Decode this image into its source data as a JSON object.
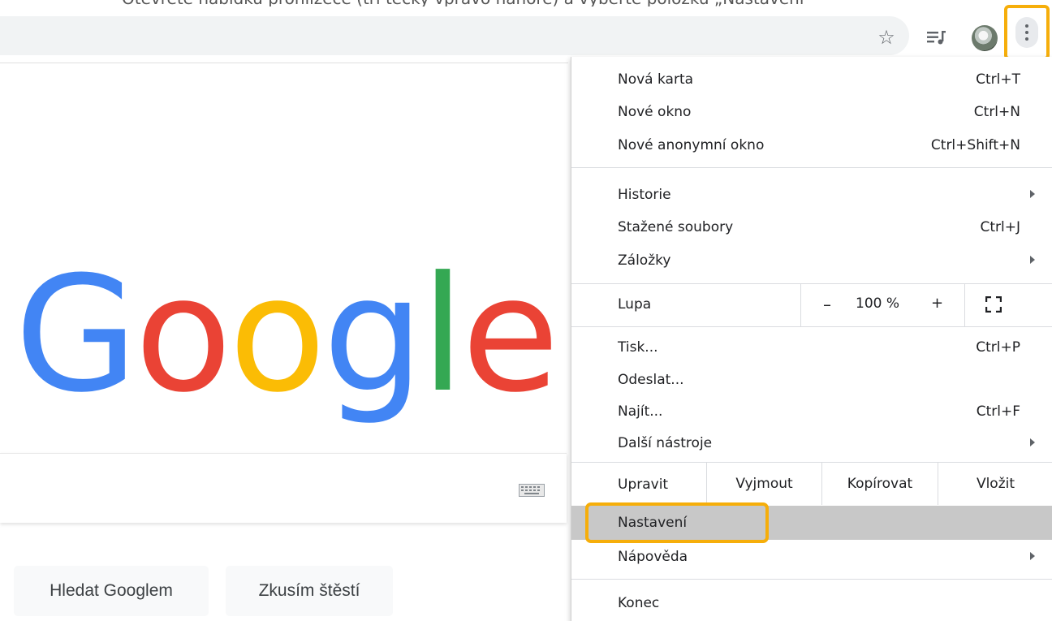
{
  "caption": "Otevřete nabídku prohlížeče (tři tečky vpravo nahoře) a vyberte položku „Nastavení“",
  "toolbar": {
    "star_icon": "star-icon",
    "media_icon": "media-control-icon",
    "avatar": "profile-avatar",
    "menu_icon": "more-vertical-icon"
  },
  "page": {
    "logo_letters": [
      "G",
      "o",
      "o",
      "g",
      "l",
      "e"
    ],
    "logo_colors": [
      "#4285F4",
      "#EA4335",
      "#FBBC05",
      "#4285F4",
      "#34A853",
      "#EA4335"
    ],
    "search_button": "Hledat Googlem",
    "lucky_button": "Zkusím štěstí"
  },
  "menu": {
    "new_tab": {
      "label": "Nová karta",
      "shortcut": "Ctrl+T"
    },
    "new_window": {
      "label": "Nové okno",
      "shortcut": "Ctrl+N"
    },
    "incognito": {
      "label": "Nové anonymní okno",
      "shortcut": "Ctrl+Shift+N"
    },
    "history": {
      "label": "Historie"
    },
    "downloads": {
      "label": "Stažené soubory",
      "shortcut": "Ctrl+J"
    },
    "bookmarks": {
      "label": "Záložky"
    },
    "zoom": {
      "label": "Lupa",
      "minus": "–",
      "value": "100 %",
      "plus": "+"
    },
    "print": {
      "label": "Tisk...",
      "shortcut": "Ctrl+P"
    },
    "cast": {
      "label": "Odeslat..."
    },
    "find": {
      "label": "Najít...",
      "shortcut": "Ctrl+F"
    },
    "more_tools": {
      "label": "Další nástroje"
    },
    "edit": {
      "label": "Upravit",
      "cut": "Vyjmout",
      "copy": "Kopírovat",
      "paste": "Vložit"
    },
    "settings": {
      "label": "Nastavení"
    },
    "help": {
      "label": "Nápověda"
    },
    "exit": {
      "label": "Konec"
    }
  },
  "colors": {
    "highlight": "#f6ae0a",
    "selected_row": "#c8c8c8"
  }
}
